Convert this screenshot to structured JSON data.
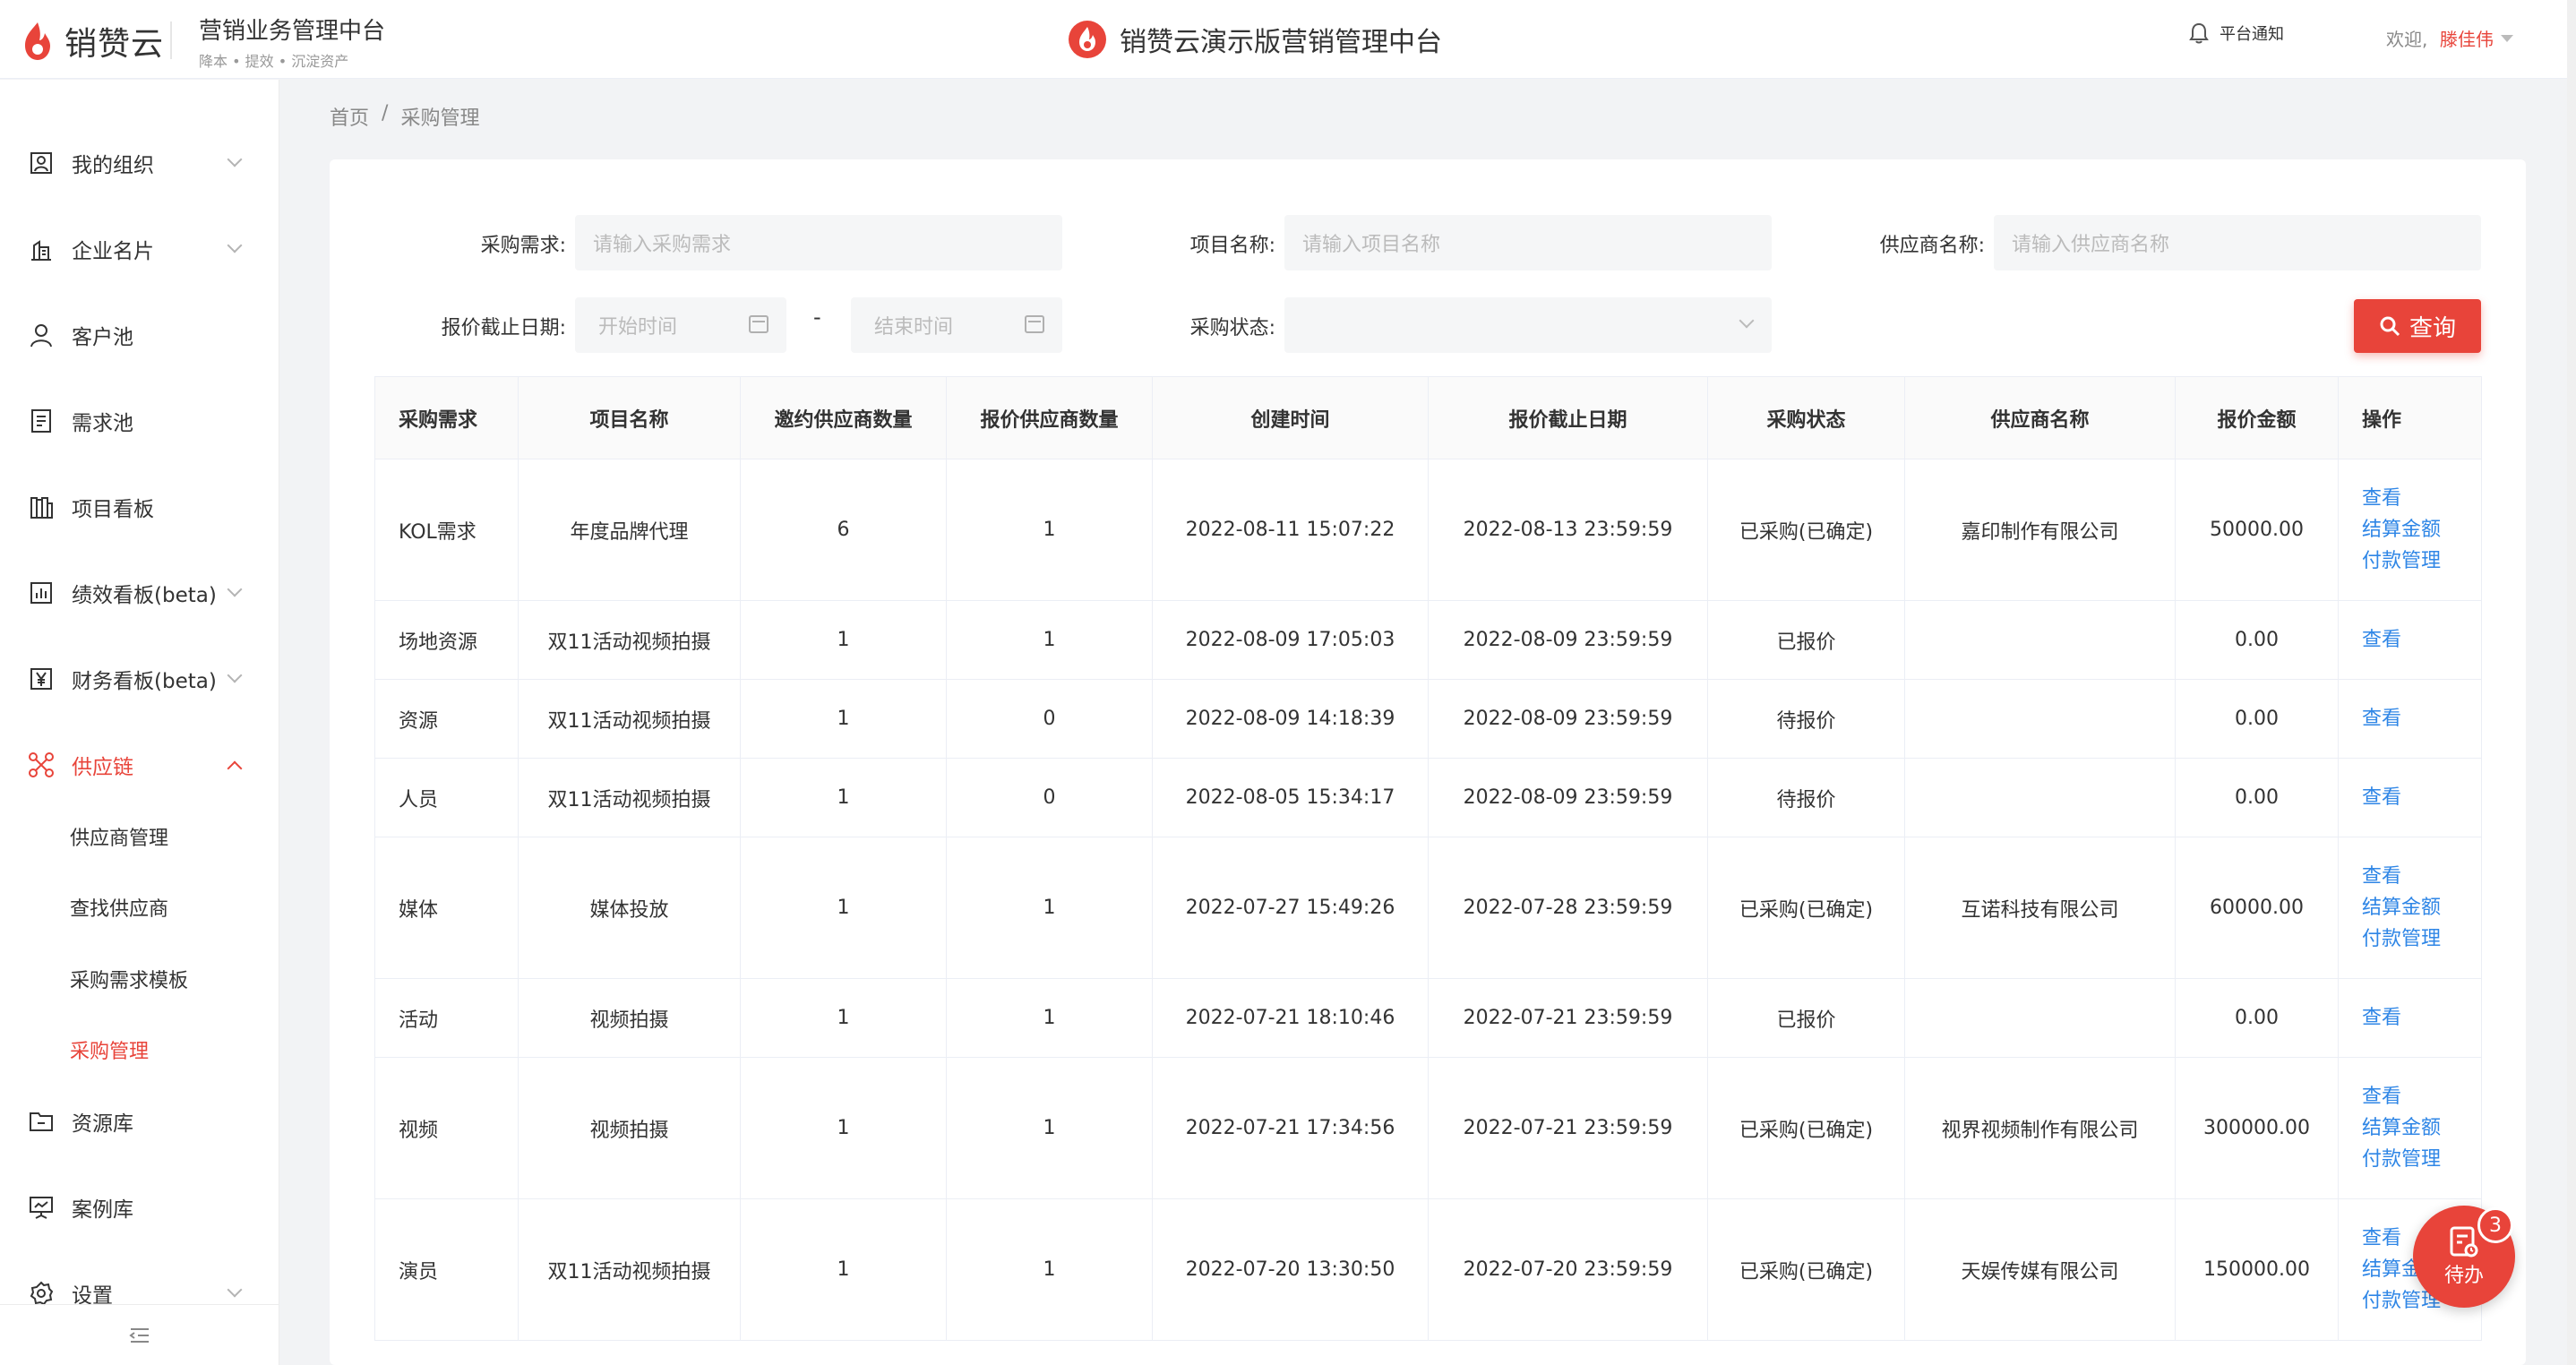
{
  "header": {
    "logo_text": "销赞云",
    "system_title": "营销业务管理中台",
    "system_subtitle": "降本 • 提效 • 沉淀资产",
    "center_title": "销赞云演示版营销管理中台",
    "notice_label": "平台通知",
    "welcome": "欢迎,",
    "user_name": "滕佳伟"
  },
  "colors": {
    "accent": "#e8443a",
    "link": "#2f86e6"
  },
  "sidebar": {
    "items": [
      {
        "label": "我的组织",
        "icon": "org-icon",
        "has_arrow": true
      },
      {
        "label": "企业名片",
        "icon": "building-icon",
        "has_arrow": true
      },
      {
        "label": "客户池",
        "icon": "user-icon",
        "has_arrow": false
      },
      {
        "label": "需求池",
        "icon": "clipboard-icon",
        "has_arrow": false
      },
      {
        "label": "项目看板",
        "icon": "board-icon",
        "has_arrow": false
      },
      {
        "label": "绩效看板(beta)",
        "icon": "chart-icon",
        "has_arrow": true
      },
      {
        "label": "财务看板(beta)",
        "icon": "yen-icon",
        "has_arrow": true
      },
      {
        "label": "供应链",
        "icon": "network-icon",
        "has_arrow": true,
        "active": true
      },
      {
        "label": "资源库",
        "icon": "folder-icon",
        "has_arrow": false
      },
      {
        "label": "案例库",
        "icon": "presentation-icon",
        "has_arrow": false
      },
      {
        "label": "设置",
        "icon": "gear-icon",
        "has_arrow": true
      }
    ],
    "sub_items": [
      {
        "label": "供应商管理"
      },
      {
        "label": "查找供应商"
      },
      {
        "label": "采购需求模板"
      },
      {
        "label": "采购管理",
        "active": true
      }
    ]
  },
  "breadcrumb": {
    "home": "首页",
    "sep": "/",
    "current": "采购管理"
  },
  "filters": {
    "demand_label": "采购需求:",
    "demand_placeholder": "请输入采购需求",
    "project_label": "项目名称:",
    "project_placeholder": "请输入项目名称",
    "supplier_label": "供应商名称:",
    "supplier_placeholder": "请输入供应商名称",
    "deadline_label": "报价截止日期:",
    "start_placeholder": "开始时间",
    "range_sep": "-",
    "end_placeholder": "结束时间",
    "status_label": "采购状态:",
    "status_value": "",
    "query_button": "查询"
  },
  "table": {
    "columns": [
      "采购需求",
      "项目名称",
      "邀约供应商数量",
      "报价供应商数量",
      "创建时间",
      "报价截止日期",
      "采购状态",
      "供应商名称",
      "报价金额",
      "操作"
    ],
    "rows": [
      {
        "demand": "KOL需求",
        "project": "年度品牌代理",
        "invited": "6",
        "quoted": "1",
        "created": "2022-08-11 15:07:22",
        "deadline": "2022-08-13 23:59:59",
        "status": "已采购(已确定)",
        "supplier": "嘉印制作有限公司",
        "amount": "50000.00",
        "ops": [
          "查看",
          "结算金额",
          "付款管理"
        ]
      },
      {
        "demand": "场地资源",
        "project": "双11活动视频拍摄",
        "invited": "1",
        "quoted": "1",
        "created": "2022-08-09 17:05:03",
        "deadline": "2022-08-09 23:59:59",
        "status": "已报价",
        "supplier": "",
        "amount": "0.00",
        "ops": [
          "查看"
        ]
      },
      {
        "demand": "资源",
        "project": "双11活动视频拍摄",
        "invited": "1",
        "quoted": "0",
        "created": "2022-08-09 14:18:39",
        "deadline": "2022-08-09 23:59:59",
        "status": "待报价",
        "supplier": "",
        "amount": "0.00",
        "ops": [
          "查看"
        ]
      },
      {
        "demand": "人员",
        "project": "双11活动视频拍摄",
        "invited": "1",
        "quoted": "0",
        "created": "2022-08-05 15:34:17",
        "deadline": "2022-08-09 23:59:59",
        "status": "待报价",
        "supplier": "",
        "amount": "0.00",
        "ops": [
          "查看"
        ]
      },
      {
        "demand": "媒体",
        "project": "媒体投放",
        "invited": "1",
        "quoted": "1",
        "created": "2022-07-27 15:49:26",
        "deadline": "2022-07-28 23:59:59",
        "status": "已采购(已确定)",
        "supplier": "互诺科技有限公司",
        "amount": "60000.00",
        "ops": [
          "查看",
          "结算金额",
          "付款管理"
        ]
      },
      {
        "demand": "活动",
        "project": "视频拍摄",
        "invited": "1",
        "quoted": "1",
        "created": "2022-07-21 18:10:46",
        "deadline": "2022-07-21 23:59:59",
        "status": "已报价",
        "supplier": "",
        "amount": "0.00",
        "ops": [
          "查看"
        ]
      },
      {
        "demand": "视频",
        "project": "视频拍摄",
        "invited": "1",
        "quoted": "1",
        "created": "2022-07-21 17:34:56",
        "deadline": "2022-07-21 23:59:59",
        "status": "已采购(已确定)",
        "supplier": "视界视频制作有限公司",
        "amount": "300000.00",
        "ops": [
          "查看",
          "结算金额",
          "付款管理"
        ]
      },
      {
        "demand": "演员",
        "project": "双11活动视频拍摄",
        "invited": "1",
        "quoted": "1",
        "created": "2022-07-20 13:30:50",
        "deadline": "2022-07-20 23:59:59",
        "status": "已采购(已确定)",
        "supplier": "天娱传媒有限公司",
        "amount": "150000.00",
        "ops": [
          "查看",
          "结算金额",
          "付款管理"
        ]
      }
    ]
  },
  "todo": {
    "label": "待办",
    "count": "3"
  }
}
